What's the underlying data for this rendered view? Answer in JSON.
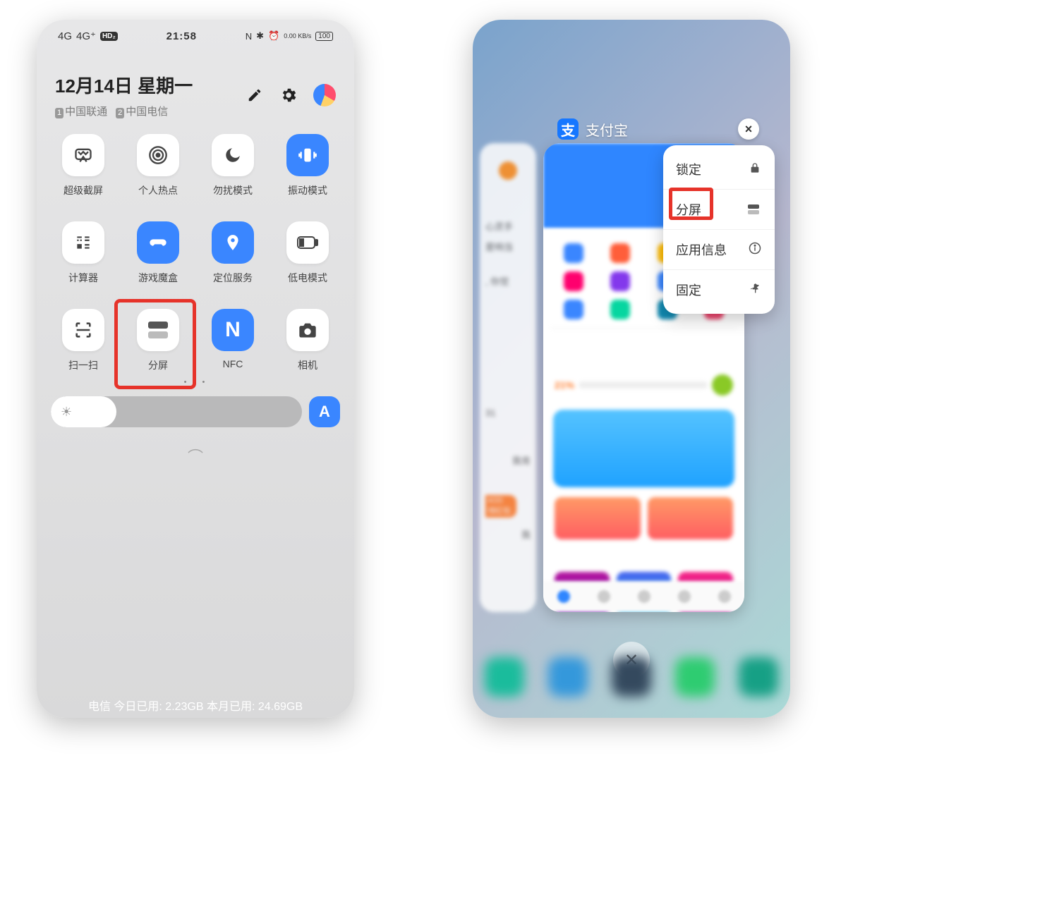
{
  "left": {
    "status": {
      "signal": "4G",
      "signal2": "4G⁺",
      "hd": "HD₂",
      "time": "21:58",
      "nfc": "N",
      "bt": "✱",
      "alarm": "⏰",
      "net_speed": "0.00 KB/s",
      "battery": "100"
    },
    "date": "12月14日 星期一",
    "sim1_badge": "1",
    "sim1": "中国联通",
    "sim2_badge": "2",
    "sim2": "中国电信",
    "tiles": [
      {
        "label": "超级截屏"
      },
      {
        "label": "个人热点"
      },
      {
        "label": "勿扰模式"
      },
      {
        "label": "振动模式"
      },
      {
        "label": "计算器"
      },
      {
        "label": "游戏魔盒"
      },
      {
        "label": "定位服务"
      },
      {
        "label": "低电模式"
      },
      {
        "label": "扫一扫"
      },
      {
        "label": "分屏"
      },
      {
        "label": "NFC"
      },
      {
        "label": "相机"
      }
    ],
    "auto_brightness": "A",
    "footer": "电信  今日已用: 2.23GB  本月已用: 24.69GB"
  },
  "right": {
    "app_name": "支付宝",
    "close": "×",
    "menu": [
      {
        "label": "锁定",
        "icon": "lock-icon"
      },
      {
        "label": "分屏",
        "icon": "split-icon"
      },
      {
        "label": "应用信息",
        "icon": "info-icon"
      },
      {
        "label": "固定",
        "icon": "pin-icon"
      }
    ],
    "bg_snippets": {
      "s1": "心灵手",
      "s2": "是响当",
      "s3": ", 你觉",
      "s4": "31",
      "s5": "我肯",
      "s6": "4/20",
      "s7": "领红包",
      "s8": "我"
    }
  }
}
